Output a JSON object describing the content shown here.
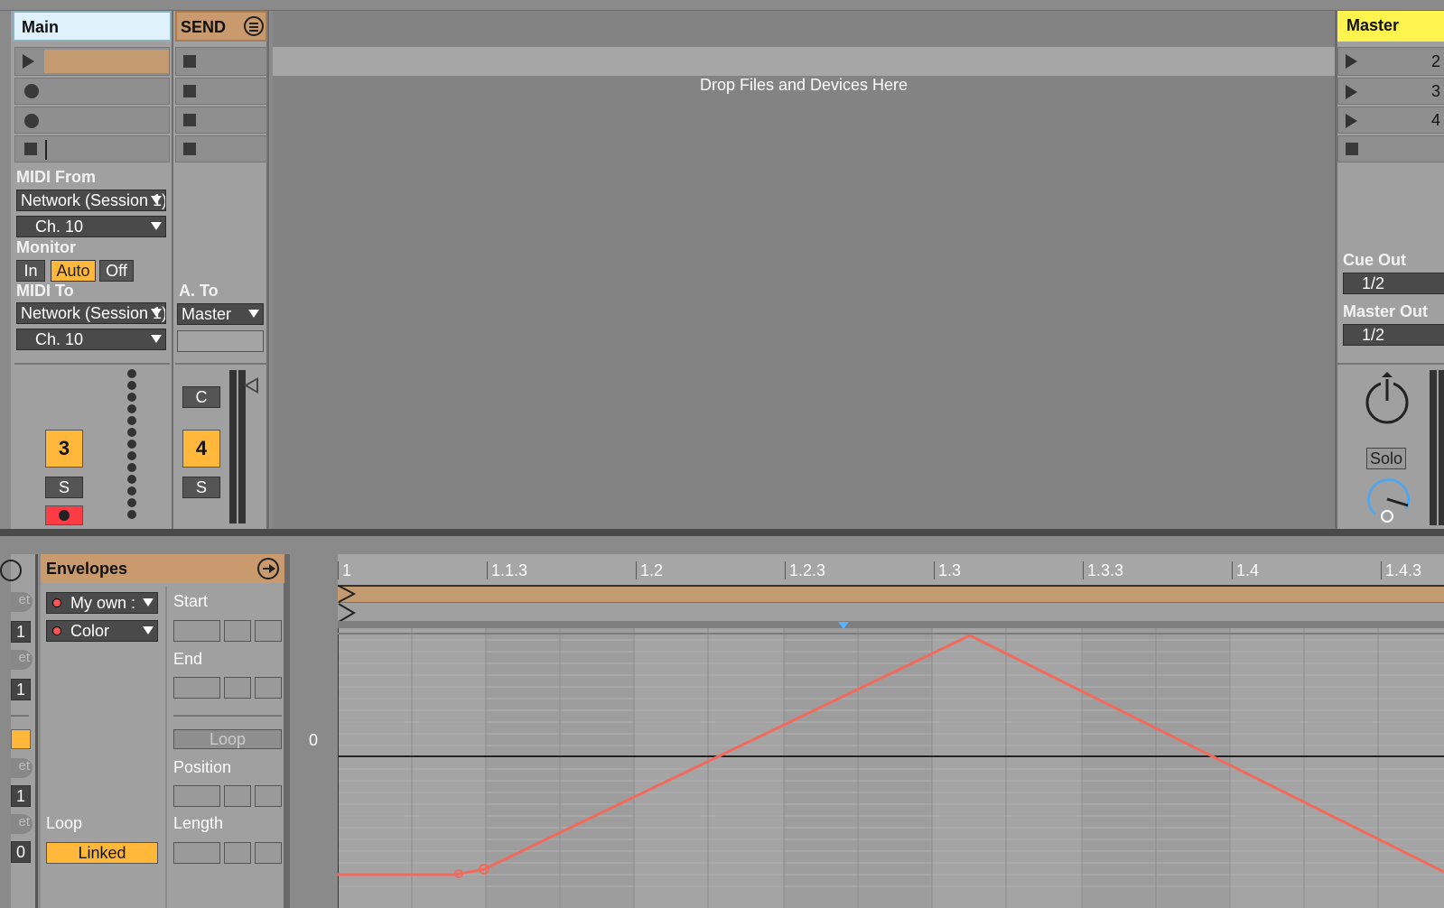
{
  "colors": {
    "main_header": "#dff2fb",
    "send_header": "#c89a6e",
    "master_header": "#fff44e",
    "accent_orange": "#ffb83a",
    "envelope_line": "#f26a5b",
    "clip_color": "#c49a70",
    "arm_red": "#ff3b46"
  },
  "tracks": {
    "main": {
      "title": "Main",
      "midi_from_label": "MIDI From",
      "midi_from_value": "Network (Session 1)",
      "midi_from_channel": "Ch. 10",
      "monitor_label": "Monitor",
      "monitor_in": "In",
      "monitor_auto": "Auto",
      "monitor_off": "Off",
      "midi_to_label": "MIDI To",
      "midi_to_value": "Network (Session 1)",
      "midi_to_channel": "Ch. 10",
      "track_number": "3",
      "solo": "S"
    },
    "send": {
      "title": "SEND",
      "audio_to_label": "A. To",
      "audio_to_value": "Master",
      "cue": "C",
      "track_number": "4",
      "solo": "S"
    },
    "drop_zone": "Drop Files and Devices Here",
    "master": {
      "title": "Master",
      "scenes": [
        "2",
        "3",
        "4"
      ],
      "cue_out_label": "Cue Out",
      "cue_out_value": "1/2",
      "master_out_label": "Master Out",
      "master_out_value": "1/2",
      "solo": "Solo"
    }
  },
  "clip_view": {
    "left_labels": [
      "et",
      "1",
      "et",
      "1",
      "et",
      "1",
      "et",
      "0"
    ],
    "envelopes_title": "Envelopes",
    "device_chooser": "My own :",
    "control_chooser": "Color",
    "start_label": "Start",
    "end_label": "End",
    "loop_button": "Loop",
    "position_label": "Position",
    "length_label": "Length",
    "loop_label": "Loop",
    "linked_button": "Linked",
    "zero_label": "0",
    "ruler": [
      "1",
      "1.1.3",
      "1.2",
      "1.2.3",
      "1.3",
      "1.3.3",
      "1.4",
      "1.4.3"
    ]
  }
}
